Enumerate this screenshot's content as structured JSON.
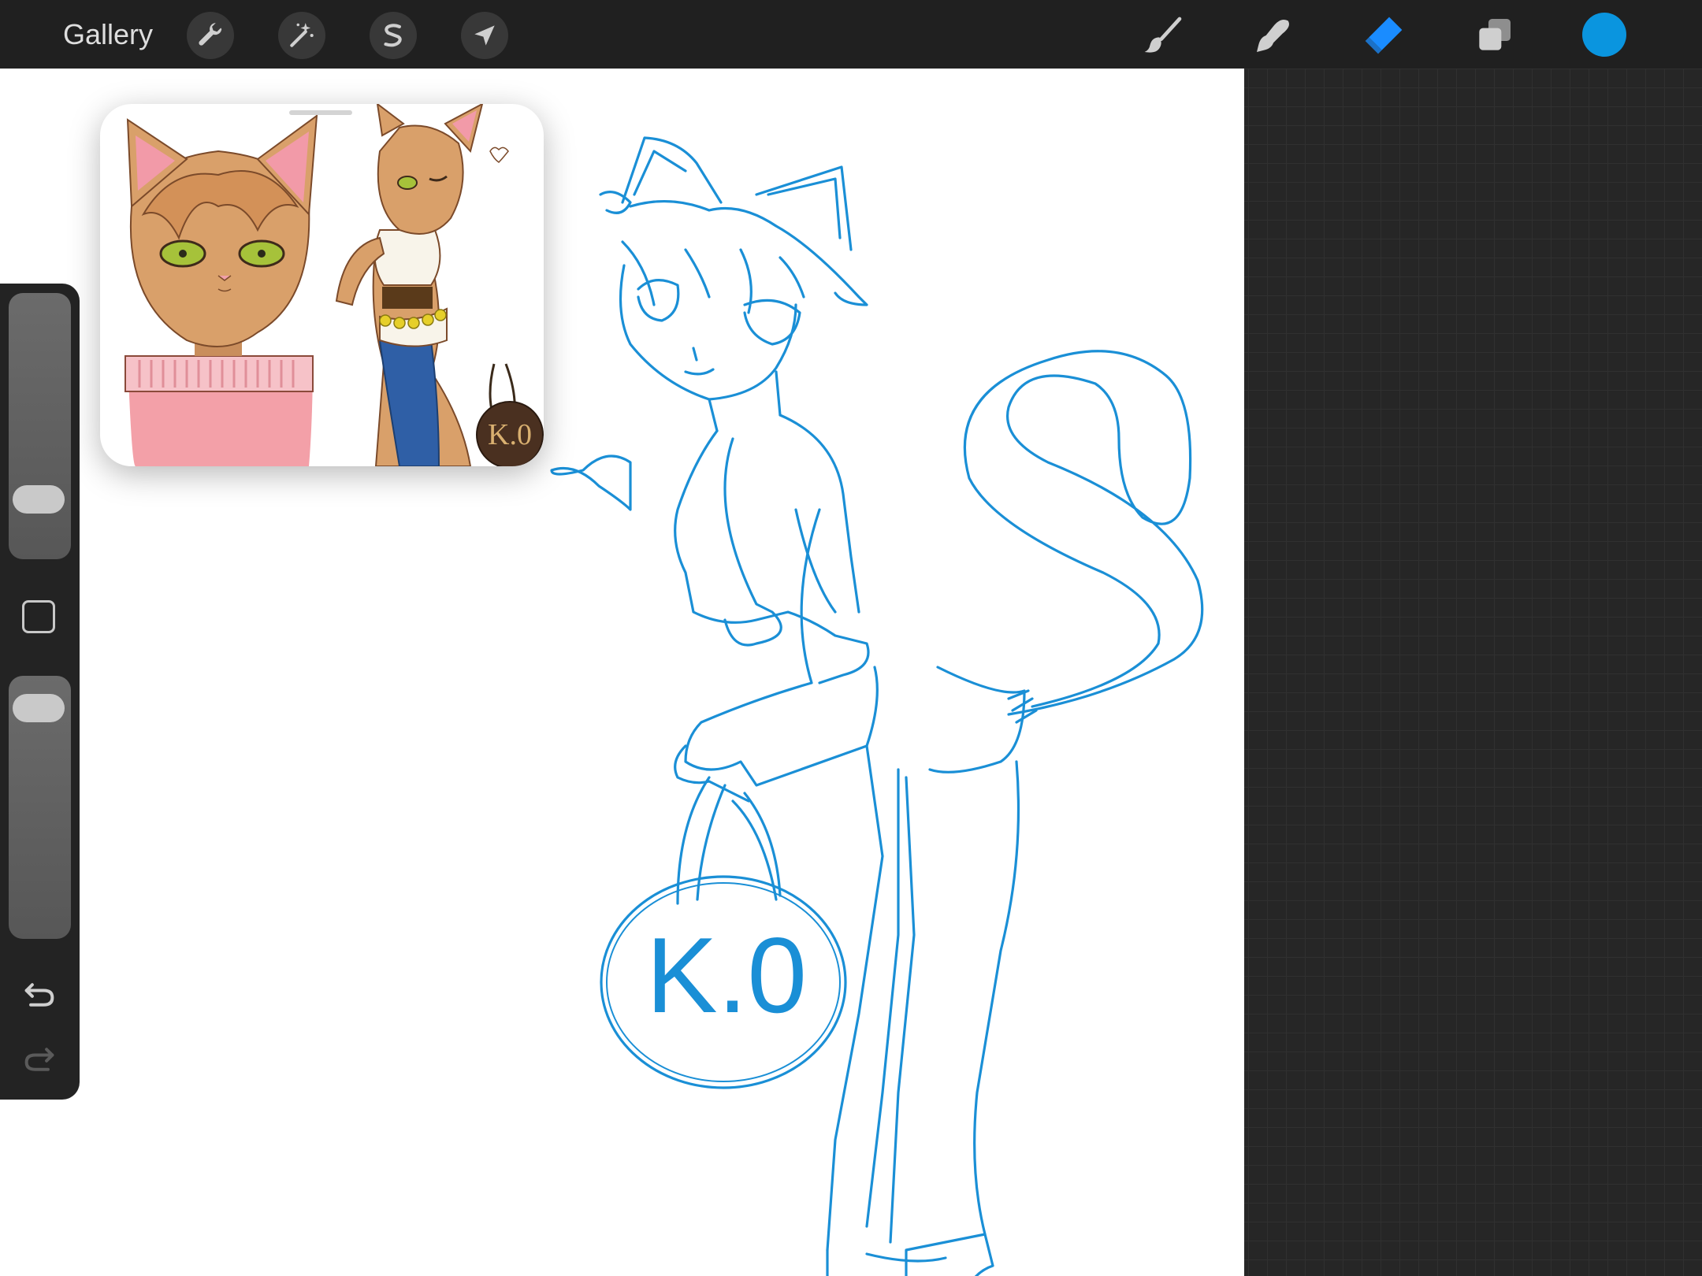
{
  "topbar": {
    "gallery_label": "Gallery",
    "left_tools": [
      {
        "name": "actions",
        "icon": "wrench-icon"
      },
      {
        "name": "adjustments",
        "icon": "magic-wand-icon"
      },
      {
        "name": "selection",
        "icon": "selection-s-icon"
      },
      {
        "name": "transform",
        "icon": "arrow-cursor-icon"
      }
    ],
    "right_tools": [
      {
        "name": "brush",
        "icon": "brush-icon"
      },
      {
        "name": "smudge",
        "icon": "smudge-finger-icon"
      },
      {
        "name": "eraser",
        "icon": "eraser-icon",
        "active": true
      },
      {
        "name": "layers",
        "icon": "layers-icon"
      }
    ],
    "current_color": "#0a95df",
    "active_tool_color": "#1a8cff"
  },
  "sidebar": {
    "brush_size_level": 0.82,
    "opacity_level": 0.06,
    "undo_icon": "undo-icon",
    "redo_icon": "redo-icon"
  },
  "canvas": {
    "stroke_color": "#1a8fd6",
    "bag_text": "K.0",
    "reference_bag_text": "K.0"
  },
  "colors": {
    "canvas_bg": "#ffffff",
    "workspace_bg": "#262626",
    "fur": "#d9a06a",
    "pink_top": "#f3a0a8",
    "jeans": "#2f5fa6",
    "eye": "#a6c23a"
  }
}
